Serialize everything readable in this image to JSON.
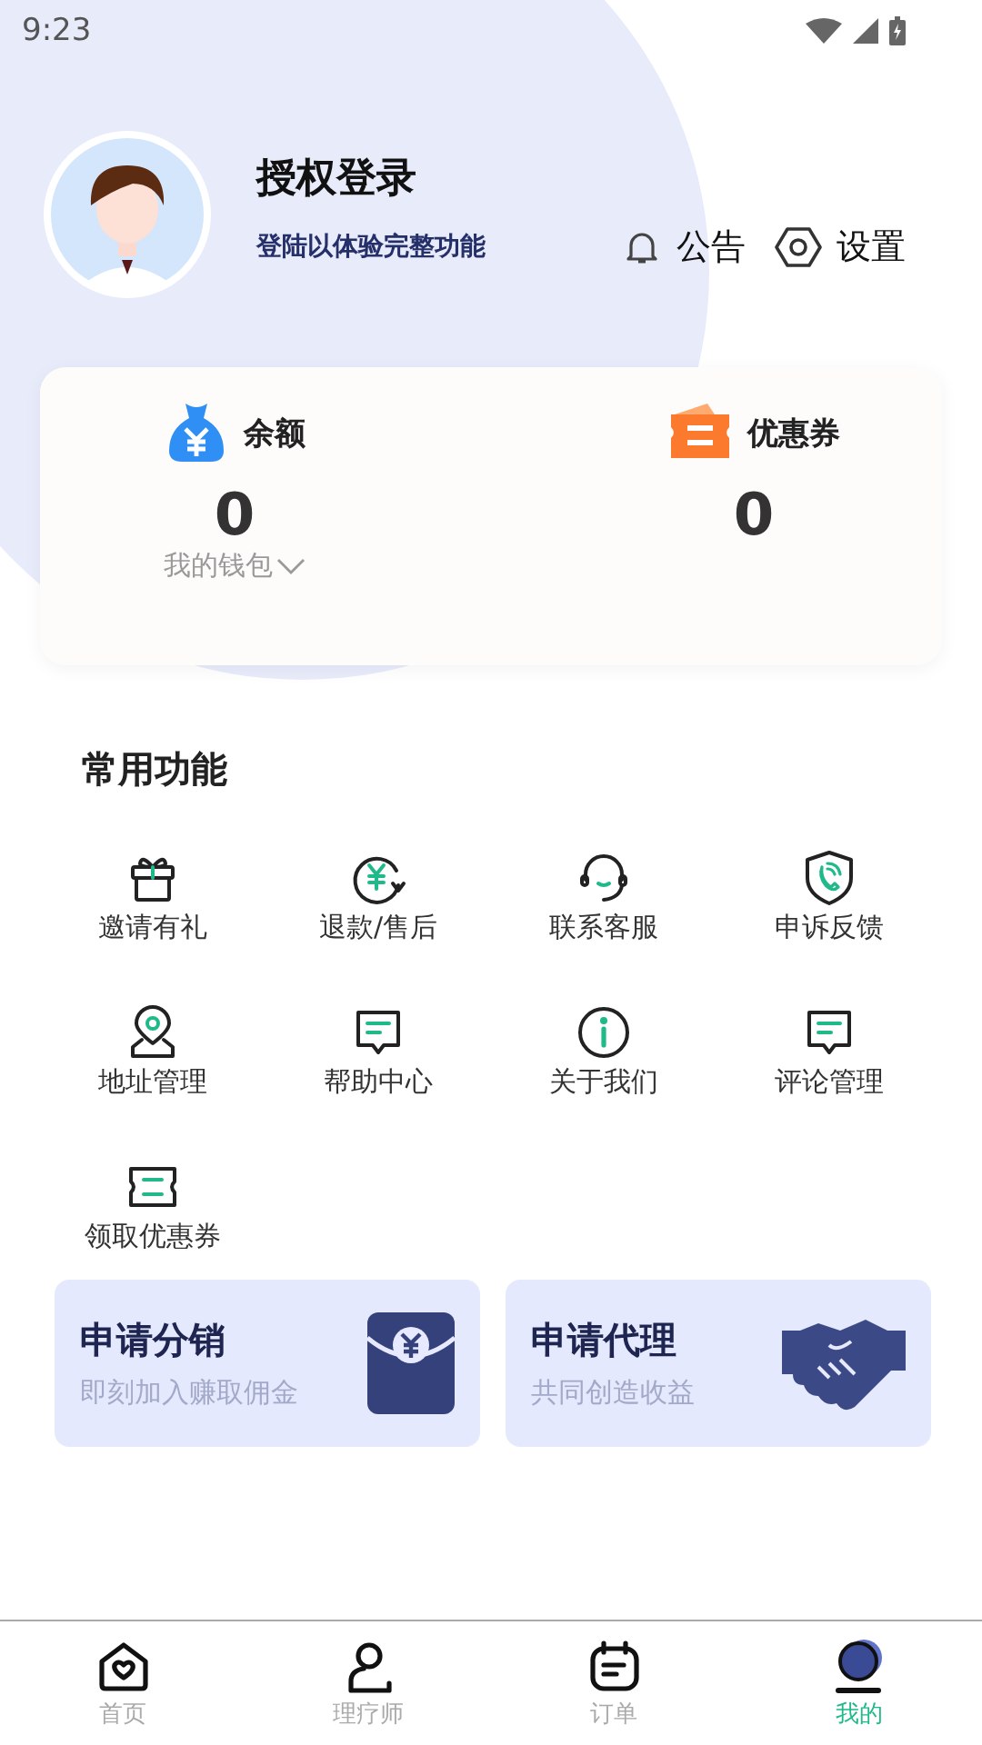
{
  "status_bar": {
    "time": "9:23"
  },
  "profile": {
    "name": "授权登录",
    "subtitle": "登陆以体验完整功能",
    "actions": [
      {
        "label": "公告"
      },
      {
        "label": "设置"
      }
    ]
  },
  "wallet": [
    {
      "label": "余额",
      "value": "0",
      "link": "我的钱包"
    },
    {
      "label": "优惠券",
      "value": "0"
    }
  ],
  "features": {
    "title": "常用功能",
    "items": [
      {
        "label": "邀请有礼"
      },
      {
        "label": "退款/售后"
      },
      {
        "label": "联系客服"
      },
      {
        "label": "申诉反馈"
      },
      {
        "label": "地址管理"
      },
      {
        "label": "帮助中心"
      },
      {
        "label": "关于我们"
      },
      {
        "label": "评论管理"
      },
      {
        "label": "领取优惠券"
      }
    ]
  },
  "promos": [
    {
      "title": "申请分销",
      "subtitle": "即刻加入赚取佣金"
    },
    {
      "title": "申请代理",
      "subtitle": "共同创造收益"
    }
  ],
  "tab_bar": [
    {
      "label": "首页",
      "selected": false
    },
    {
      "label": "理疗师",
      "selected": false
    },
    {
      "label": "订单",
      "selected": false
    },
    {
      "label": "我的",
      "selected": true
    }
  ]
}
